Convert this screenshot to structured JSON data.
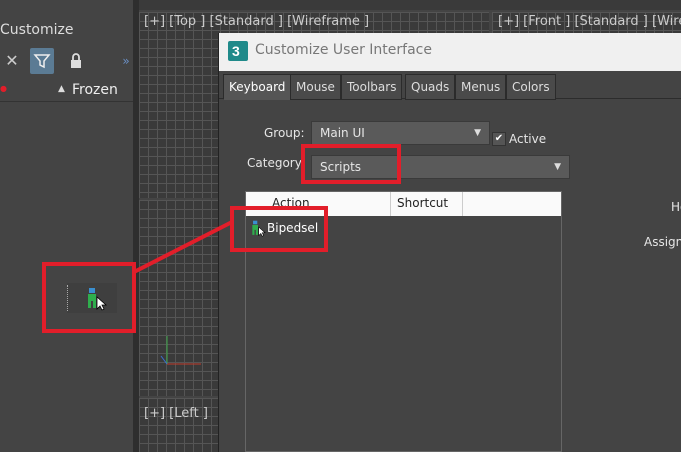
{
  "left_panel": {
    "title": "Customize",
    "column_frozen": "Frozen",
    "icons": [
      "close-icon",
      "filter-icon",
      "lock-icon",
      "expand-icon"
    ]
  },
  "viewports": {
    "top_label": "[+] [Top ] [Standard ] [Wireframe ]",
    "front_label": "[+] [Front ] [Standard ] [Wirefr",
    "left_label": "[+] [Left ]"
  },
  "dialog": {
    "title": "Customize User Interface",
    "tabs": [
      "Keyboard",
      "Mouse",
      "Toolbars",
      "Quads",
      "Menus",
      "Colors"
    ],
    "active_tab": "Keyboard",
    "group_label": "Group:",
    "group_value": "Main UI",
    "active_label": "Active",
    "category_label": "Category",
    "category_value": "Scripts",
    "list_headers": [
      "Action",
      "Shortcut"
    ],
    "list_items": [
      "Bipedsel"
    ],
    "right_label_1": "Ho",
    "right_label_2": "Assign"
  },
  "colors": {
    "highlight": "#e21e2a"
  }
}
